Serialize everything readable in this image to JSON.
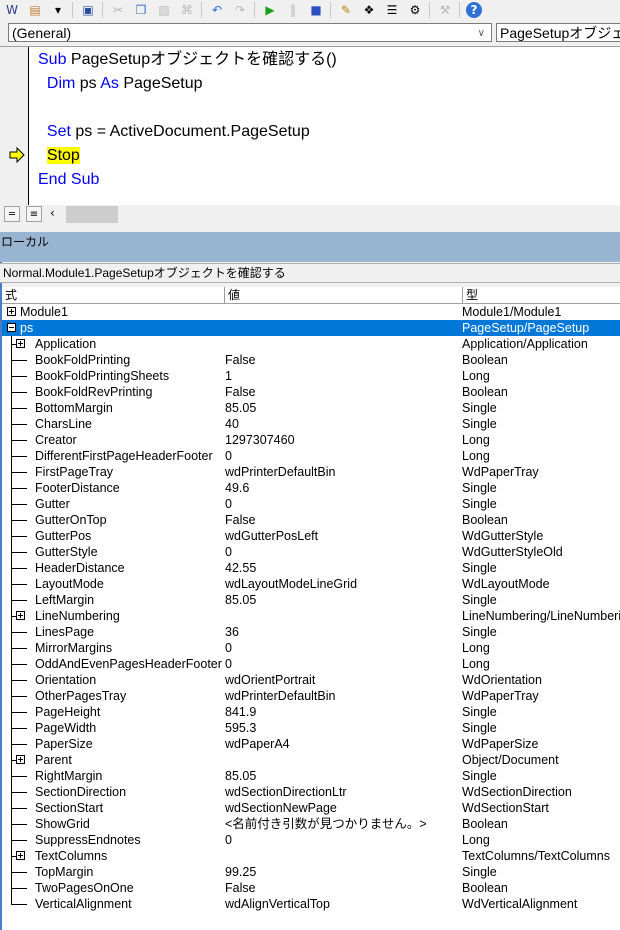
{
  "toolbar": {
    "buttons": [
      {
        "icon": "word-icon",
        "enabled": true
      },
      {
        "icon": "insert-module-icon",
        "enabled": true
      },
      {
        "icon": "dropdown-arrow-icon",
        "enabled": true
      },
      {
        "icon": "save-icon",
        "enabled": true
      },
      {
        "icon": "cut-icon",
        "enabled": false
      },
      {
        "icon": "copy-icon",
        "enabled": true
      },
      {
        "icon": "paste-icon",
        "enabled": false
      },
      {
        "icon": "find-icon",
        "enabled": false
      },
      {
        "icon": "undo-icon",
        "enabled": true
      },
      {
        "icon": "redo-icon",
        "enabled": false
      },
      {
        "icon": "run-icon",
        "enabled": true
      },
      {
        "icon": "break-icon",
        "enabled": false
      },
      {
        "icon": "reset-icon",
        "enabled": true
      },
      {
        "icon": "design-mode-icon",
        "enabled": true
      },
      {
        "icon": "project-explorer-icon",
        "enabled": true
      },
      {
        "icon": "properties-icon",
        "enabled": true
      },
      {
        "icon": "object-browser-icon",
        "enabled": true
      },
      {
        "icon": "toolbox-icon",
        "enabled": false
      },
      {
        "icon": "help-icon",
        "enabled": true
      }
    ]
  },
  "object_combo": {
    "value": "(General)"
  },
  "procedure_combo": {
    "value": "PageSetupオブジェクトを確認する"
  },
  "code": {
    "lines": [
      {
        "parts": [
          {
            "t": "Sub ",
            "k": true
          },
          {
            "t": "PageSetupオブジェクトを確認する()"
          }
        ]
      },
      {
        "parts": [
          {
            "t": "  "
          },
          {
            "t": "Dim",
            "k": true
          },
          {
            "t": " ps "
          },
          {
            "t": "As",
            "k": true
          },
          {
            "t": " PageSetup"
          }
        ]
      },
      {
        "parts": [
          {
            "t": ""
          }
        ]
      },
      {
        "parts": [
          {
            "t": "  "
          },
          {
            "t": "Set",
            "k": true
          },
          {
            "t": " ps = ActiveDocument.PageSetup"
          }
        ]
      },
      {
        "parts": [
          {
            "t": "  "
          },
          {
            "t": "Stop",
            "hl": true
          }
        ]
      },
      {
        "parts": [
          {
            "t": "End Sub",
            "k": true
          }
        ]
      }
    ],
    "current_line": 5
  },
  "locals": {
    "title": "ローカル",
    "procedure": "Normal.Module1.PageSetupオブジェクトを確認する",
    "headers": {
      "expression": "式",
      "value": "値",
      "type": "型"
    },
    "rows": [
      {
        "name": "Module1",
        "value": "",
        "type": "Module1/Module1",
        "level": 0,
        "expander": "plus"
      },
      {
        "name": "ps",
        "value": "",
        "type": "PageSetup/PageSetup",
        "level": 0,
        "expander": "minus",
        "selected": true
      },
      {
        "name": "Application",
        "value": "",
        "type": "Application/Application",
        "level": 1,
        "expander": "plus"
      },
      {
        "name": "BookFoldPrinting",
        "value": "False",
        "type": "Boolean",
        "level": 1
      },
      {
        "name": "BookFoldPrintingSheets",
        "value": "1",
        "type": "Long",
        "level": 1
      },
      {
        "name": "BookFoldRevPrinting",
        "value": "False",
        "type": "Boolean",
        "level": 1
      },
      {
        "name": "BottomMargin",
        "value": "85.05",
        "type": "Single",
        "level": 1
      },
      {
        "name": "CharsLine",
        "value": "40",
        "type": "Single",
        "level": 1
      },
      {
        "name": "Creator",
        "value": "1297307460",
        "type": "Long",
        "level": 1
      },
      {
        "name": "DifferentFirstPageHeaderFooter",
        "value": "0",
        "type": "Long",
        "level": 1
      },
      {
        "name": "FirstPageTray",
        "value": "wdPrinterDefaultBin",
        "type": "WdPaperTray",
        "level": 1
      },
      {
        "name": "FooterDistance",
        "value": "49.6",
        "type": "Single",
        "level": 1
      },
      {
        "name": "Gutter",
        "value": "0",
        "type": "Single",
        "level": 1
      },
      {
        "name": "GutterOnTop",
        "value": "False",
        "type": "Boolean",
        "level": 1
      },
      {
        "name": "GutterPos",
        "value": "wdGutterPosLeft",
        "type": "WdGutterStyle",
        "level": 1
      },
      {
        "name": "GutterStyle",
        "value": "0",
        "type": "WdGutterStyleOld",
        "level": 1
      },
      {
        "name": "HeaderDistance",
        "value": "42.55",
        "type": "Single",
        "level": 1
      },
      {
        "name": "LayoutMode",
        "value": "wdLayoutModeLineGrid",
        "type": "WdLayoutMode",
        "level": 1
      },
      {
        "name": "LeftMargin",
        "value": "85.05",
        "type": "Single",
        "level": 1
      },
      {
        "name": "LineNumbering",
        "value": "",
        "type": "LineNumbering/LineNumbering",
        "level": 1,
        "expander": "plus"
      },
      {
        "name": "LinesPage",
        "value": "36",
        "type": "Single",
        "level": 1
      },
      {
        "name": "MirrorMargins",
        "value": "0",
        "type": "Long",
        "level": 1
      },
      {
        "name": "OddAndEvenPagesHeaderFooter",
        "value": "0",
        "type": "Long",
        "level": 1
      },
      {
        "name": "Orientation",
        "value": "wdOrientPortrait",
        "type": "WdOrientation",
        "level": 1
      },
      {
        "name": "OtherPagesTray",
        "value": "wdPrinterDefaultBin",
        "type": "WdPaperTray",
        "level": 1
      },
      {
        "name": "PageHeight",
        "value": "841.9",
        "type": "Single",
        "level": 1
      },
      {
        "name": "PageWidth",
        "value": "595.3",
        "type": "Single",
        "level": 1
      },
      {
        "name": "PaperSize",
        "value": "wdPaperA4",
        "type": "WdPaperSize",
        "level": 1
      },
      {
        "name": "Parent",
        "value": "",
        "type": "Object/Document",
        "level": 1,
        "expander": "plus"
      },
      {
        "name": "RightMargin",
        "value": "85.05",
        "type": "Single",
        "level": 1
      },
      {
        "name": "SectionDirection",
        "value": "wdSectionDirectionLtr",
        "type": "WdSectionDirection",
        "level": 1
      },
      {
        "name": "SectionStart",
        "value": "wdSectionNewPage",
        "type": "WdSectionStart",
        "level": 1
      },
      {
        "name": "ShowGrid",
        "value": "<名前付き引数が見つかりません。>",
        "type": "Boolean",
        "level": 1
      },
      {
        "name": "SuppressEndnotes",
        "value": "0",
        "type": "Long",
        "level": 1
      },
      {
        "name": "TextColumns",
        "value": "",
        "type": "TextColumns/TextColumns",
        "level": 1,
        "expander": "plus"
      },
      {
        "name": "TopMargin",
        "value": "99.25",
        "type": "Single",
        "level": 1
      },
      {
        "name": "TwoPagesOnOne",
        "value": "False",
        "type": "Boolean",
        "level": 1
      },
      {
        "name": "VerticalAlignment",
        "value": "wdAlignVerticalTop",
        "type": "WdVerticalAlignment",
        "level": 1
      }
    ]
  },
  "colors": {
    "keyword": "#0000ff",
    "stop_highlight": "#ffff00",
    "selection": "#0078d7",
    "locals_title_bar": "#99b4d1"
  }
}
